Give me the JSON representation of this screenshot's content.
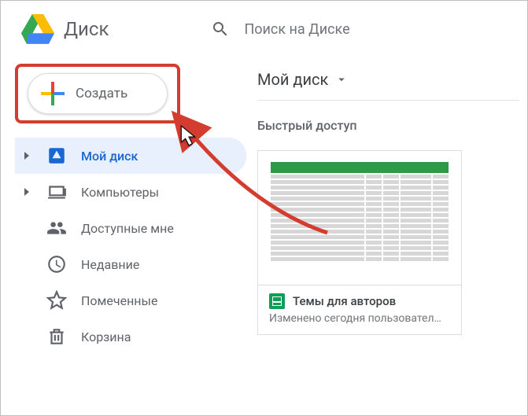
{
  "app": {
    "title": "Диск"
  },
  "search": {
    "placeholder": "Поиск на Диске"
  },
  "toolbar": {
    "create_label": "Создать"
  },
  "sidebar": {
    "items": [
      {
        "label": "Мой диск"
      },
      {
        "label": "Компьютеры"
      },
      {
        "label": "Доступные мне"
      },
      {
        "label": "Недавние"
      },
      {
        "label": "Помеченные"
      },
      {
        "label": "Корзина"
      }
    ]
  },
  "main": {
    "location": "Мой диск",
    "quick_label": "Быстрый доступ",
    "card": {
      "title": "Темы для авторов",
      "subtitle": "Изменено сегодня пользовател…"
    }
  }
}
